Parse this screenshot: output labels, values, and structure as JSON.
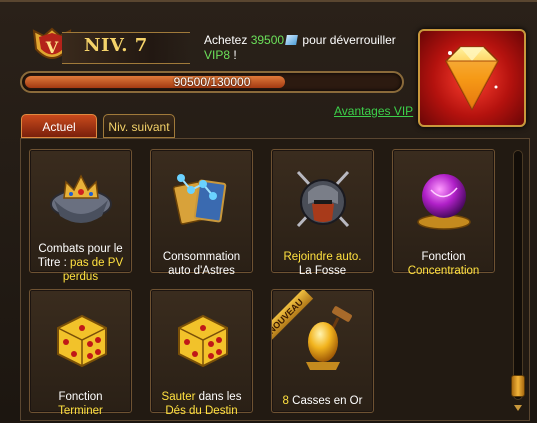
{
  "header": {
    "level_badge": "V",
    "level_label": "NIV. 7",
    "buy_prefix": "Achetez",
    "buy_amount": "39500",
    "buy_middle": "pour déverrouiller",
    "buy_target": "VIP8",
    "buy_suffix": " !",
    "progress_text": "90500/130000",
    "progress_fraction": 0.696,
    "vip_link": "Avantages VIP"
  },
  "tabs": {
    "current": "Actuel",
    "next": "Niv. suivant"
  },
  "features": [
    {
      "line1": "Combats pour le",
      "line2a": "Titre : ",
      "line2b": "pas de PV",
      "line3": "perdus",
      "icon": "crown-shield-icon"
    },
    {
      "line1": "Consommation",
      "line2": "auto d'Astres",
      "icon": "astral-cards-icon"
    },
    {
      "line1": "Rejoindre auto.",
      "line2": "La Fosse",
      "icon": "warrior-helmet-icon"
    },
    {
      "line1": "Fonction",
      "line2": "Concentration",
      "icon": "purple-orb-icon"
    },
    {
      "line1": "Fonction",
      "line2": "Terminer",
      "icon": "dice-icon"
    },
    {
      "line1a": "Sauter",
      "line1b": " dans les",
      "line2": "Dés du Destin",
      "icon": "dice-icon"
    },
    {
      "ribbon": "NOUVEAU",
      "num": "8",
      "text": " Casses en Or",
      "icon": "golden-egg-icon"
    }
  ],
  "colors": {
    "accent_gold": "#f5d36a",
    "highlight_yellow": "#ffe140",
    "link_green": "#3cd04a",
    "progress_fill": "#c4501e"
  }
}
